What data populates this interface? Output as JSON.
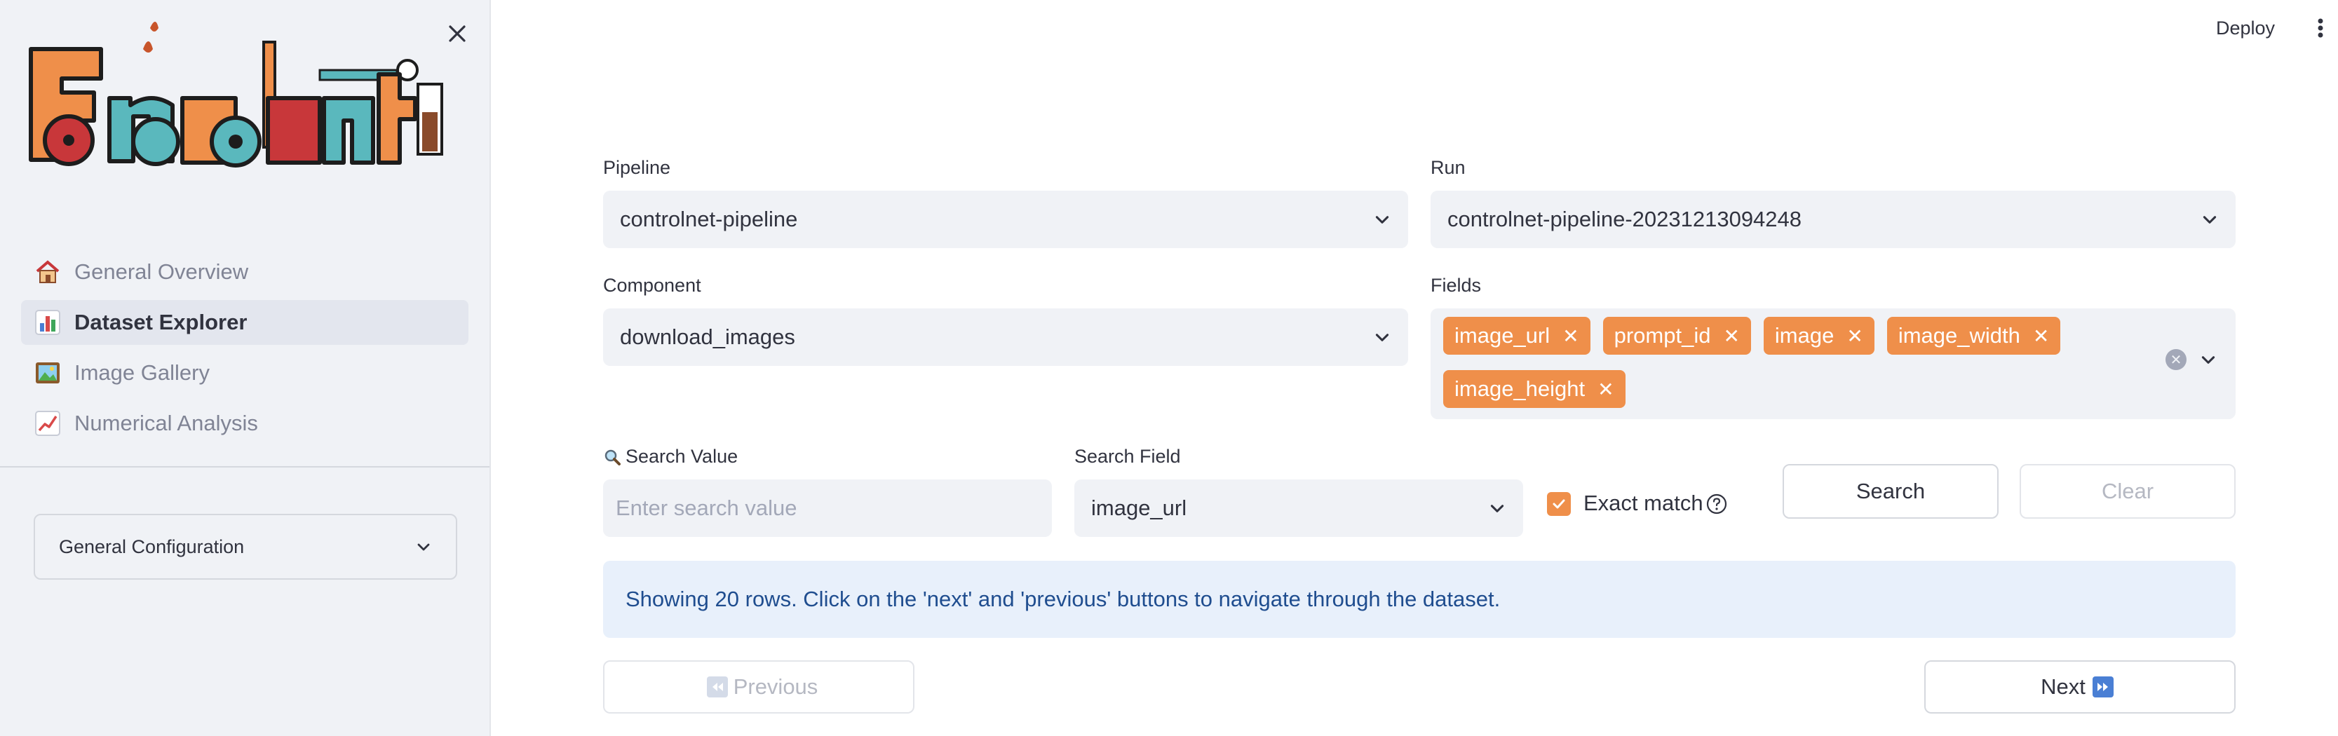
{
  "header": {
    "deploy_label": "Deploy"
  },
  "sidebar": {
    "logo_text": "fondant",
    "nav": [
      {
        "label": "General Overview",
        "icon": "house-icon",
        "active": false
      },
      {
        "label": "Dataset Explorer",
        "icon": "bar-chart-icon",
        "active": true
      },
      {
        "label": "Image Gallery",
        "icon": "picture-icon",
        "active": false
      },
      {
        "label": "Numerical Analysis",
        "icon": "line-chart-icon",
        "active": false
      }
    ],
    "config_label": "General Configuration"
  },
  "form": {
    "pipeline": {
      "label": "Pipeline",
      "value": "controlnet-pipeline"
    },
    "run": {
      "label": "Run",
      "value": "controlnet-pipeline-20231213094248"
    },
    "component": {
      "label": "Component",
      "value": "download_images"
    },
    "fields": {
      "label": "Fields",
      "tags": [
        "image_url",
        "prompt_id",
        "image",
        "image_width",
        "image_height"
      ]
    },
    "search_value": {
      "label": "Search Value",
      "icon": "magnifier-icon",
      "placeholder": "Enter search value",
      "value": ""
    },
    "search_field": {
      "label": "Search Field",
      "value": "image_url"
    },
    "exact_match": {
      "label": "Exact match",
      "checked": true
    },
    "search_button": "Search",
    "clear_button": "Clear"
  },
  "info": {
    "message": "Showing 20 rows. Click on the 'next' and 'previous' buttons to navigate through the dataset."
  },
  "pagination": {
    "previous_label": "Previous",
    "next_label": "Next"
  },
  "colors": {
    "accent": "#ef8f4a",
    "info_bg": "#e8f0fb",
    "info_text": "#1f4d8f",
    "sidebar_bg": "#f0f2f6"
  }
}
